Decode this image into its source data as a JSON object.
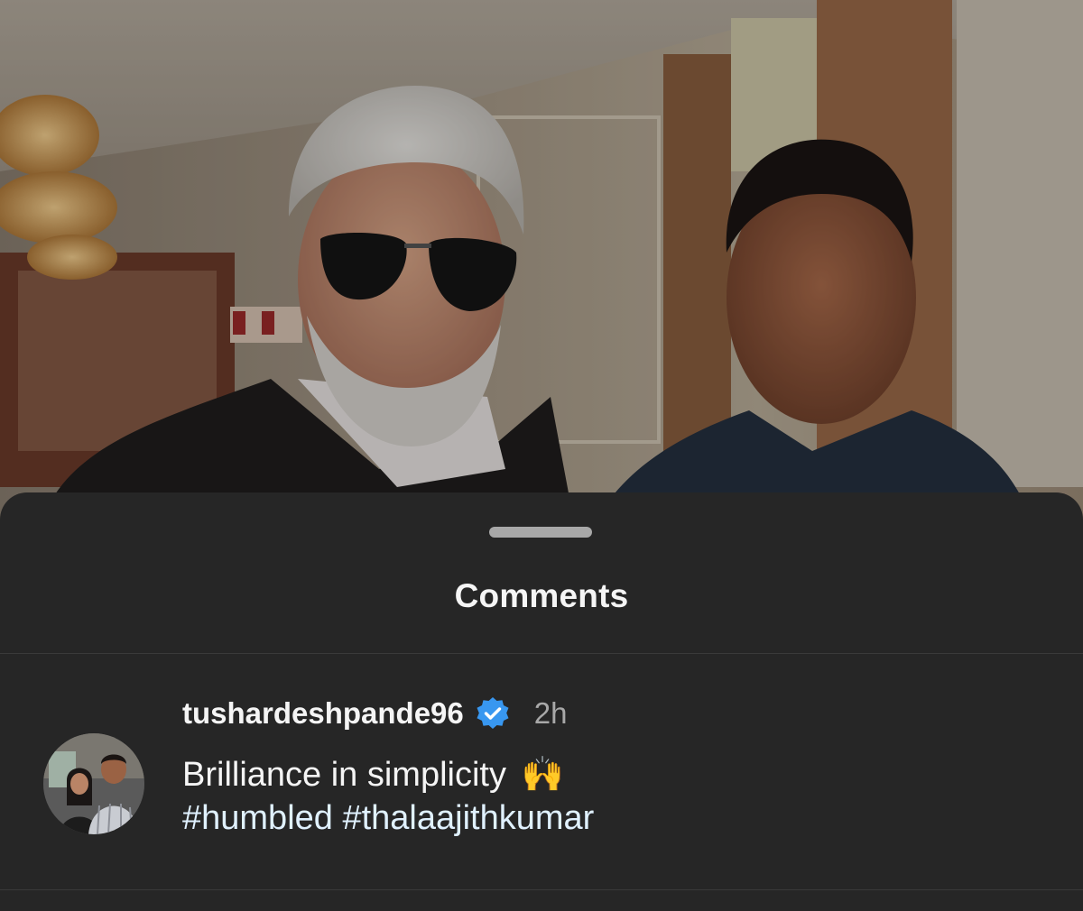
{
  "sheet": {
    "title": "Comments"
  },
  "comment": {
    "username": "tushardeshpande96",
    "verified": true,
    "timestamp": "2h",
    "text": "Brilliance in simplicity",
    "emoji": "🙌",
    "hashtags": "#humbled #thalaajithkumar"
  },
  "colors": {
    "sheet_background": "#262626",
    "primary_text": "#f5f5f5",
    "secondary_text": "#a8a8a8",
    "verified_badge": "#3897f0",
    "hashtag": "#e0f1ff"
  },
  "icons": {
    "verified": "verified-badge-icon",
    "drag_handle": "drag-handle"
  }
}
